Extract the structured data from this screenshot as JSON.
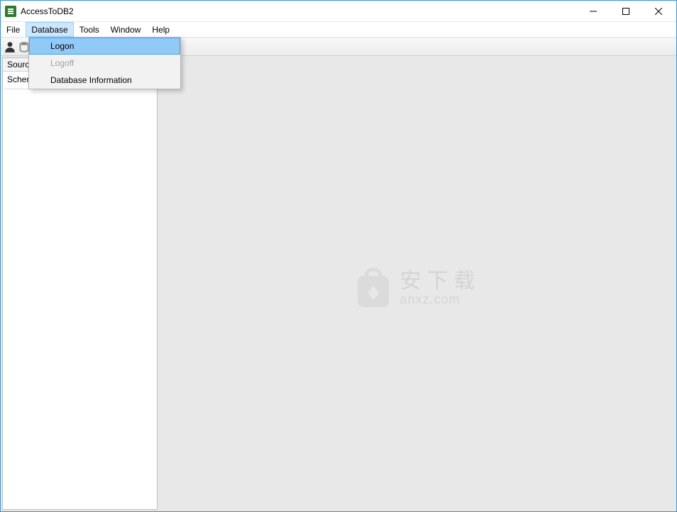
{
  "window": {
    "title": "AccessToDB2"
  },
  "menubar": {
    "items": [
      {
        "label": "File"
      },
      {
        "label": "Database"
      },
      {
        "label": "Tools"
      },
      {
        "label": "Window"
      },
      {
        "label": "Help"
      }
    ],
    "active_index": 1
  },
  "dropdown": {
    "items": [
      {
        "label": "Logon",
        "state": "highlight"
      },
      {
        "label": "Logoff",
        "state": "disabled"
      },
      {
        "label": "Database Information",
        "state": "normal"
      }
    ]
  },
  "left_panel": {
    "tab_label": "Source",
    "schema_label": "Schema"
  },
  "watermark": {
    "cn": "安下载",
    "en": "anxz.com"
  }
}
